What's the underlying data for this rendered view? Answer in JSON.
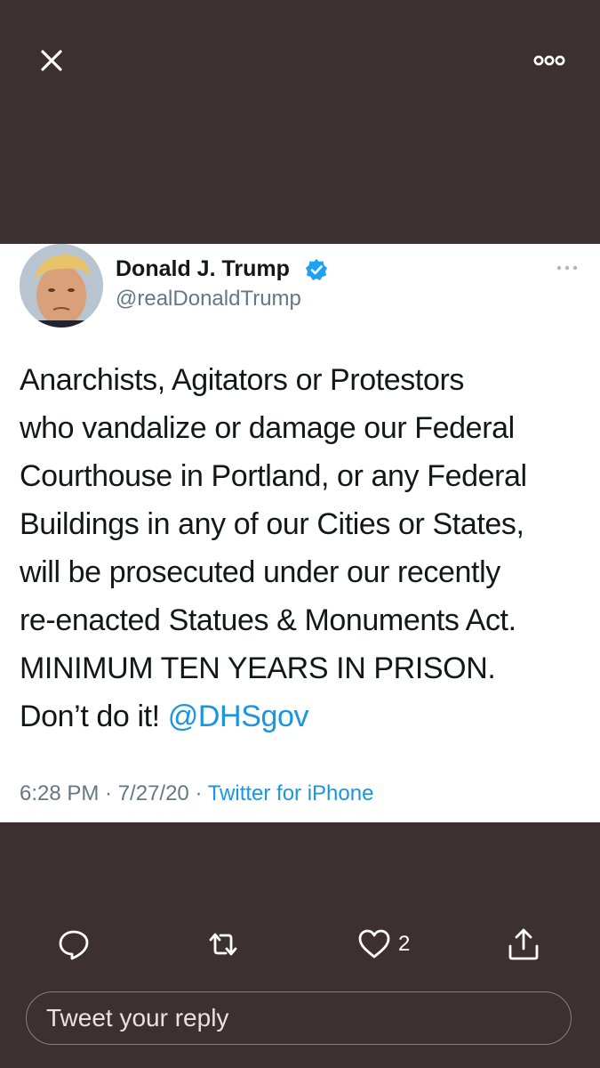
{
  "viewer": {
    "close_icon": "close-icon",
    "more_icon": "more-horizontal-icon"
  },
  "tweet": {
    "display_name": "Donald J. Trump",
    "handle": "@realDonaldTrump",
    "verified": true,
    "avatar_icon": "avatar",
    "text_main": "Anarchists, Agitators or Protestors\nwho vandalize or damage our Federal\nCourthouse in Portland, or any Federal\nBuildings in any of our Cities or States,\nwill be prosecuted under our recently\nre-enacted Statues & Monuments Act.\nMINIMUM TEN YEARS IN PRISON.\nDon’t do it! ",
    "mention": "@DHSgov",
    "time": "6:28 PM · 7/27/20 · ",
    "source": "Twitter for iPhone"
  },
  "actions": {
    "reply_icon": "reply-icon",
    "retweet_icon": "retweet-icon",
    "like_icon": "heart-icon",
    "like_count": "2",
    "share_icon": "share-icon"
  },
  "reply_input": {
    "placeholder": "Tweet your reply"
  },
  "colors": {
    "background": "#3d3030",
    "card": "#ffffff",
    "link": "#1b95e0",
    "secondary_text": "#657786"
  }
}
